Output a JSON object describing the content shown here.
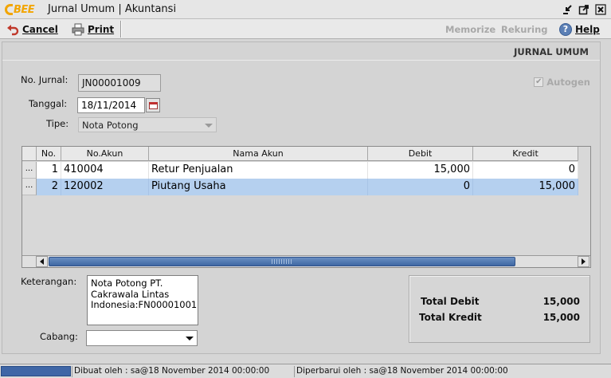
{
  "window": {
    "logo_text": "BEE",
    "title": "Jurnal Umum | Akuntansi"
  },
  "toolbar": {
    "cancel_label": "Cancel",
    "print_label": "Print",
    "memorize_label": "Memorize",
    "rekuring_label": "Rekuring",
    "help_label": "Help"
  },
  "form": {
    "heading": "JURNAL UMUM",
    "no_jurnal_label": "No. Jurnal:",
    "no_jurnal_value": "JN00001009",
    "tanggal_label": "Tanggal:",
    "tanggal_value": "18/11/2014",
    "tipe_label": "Tipe:",
    "tipe_value": "Nota Potong",
    "autogen_label": "Autogen",
    "autogen_checked": true,
    "keterangan_label": "Keterangan:",
    "keterangan_value": "Nota Potong PT.\nCakrawala Lintas\nIndonesia:FN00001001",
    "cabang_label": "Cabang:",
    "cabang_value": ""
  },
  "table": {
    "columns": [
      "No.",
      "No.Akun",
      "Nama Akun",
      "Debit",
      "Kredit"
    ],
    "rows": [
      {
        "ell": "...",
        "no": "1",
        "no_akun": "410004",
        "nama_akun": "Retur Penjualan",
        "debit": "15,000",
        "kredit": "0",
        "selected": false
      },
      {
        "ell": "...",
        "no": "2",
        "no_akun": "120002",
        "nama_akun": "Piutang Usaha",
        "debit": "0",
        "kredit": "15,000",
        "selected": true
      }
    ]
  },
  "totals": {
    "debit_label": "Total Debit",
    "debit_value": "15,000",
    "kredit_label": "Total Kredit",
    "kredit_value": "15,000"
  },
  "status": {
    "created": "Dibuat oleh : sa@18 November 2014  00:00:00",
    "updated": "Diperbarui oleh : sa@18 November 2014  00:00:00"
  },
  "colors": {
    "selection": "#b5d0ef",
    "accent": "#3f66a6",
    "logo": "#f2a500"
  }
}
